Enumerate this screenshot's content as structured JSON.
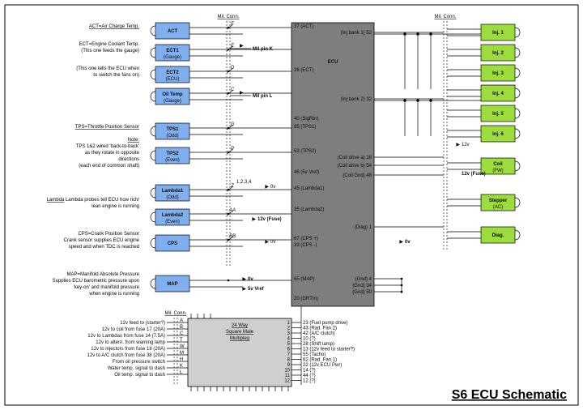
{
  "title": "S6 ECU Schematic",
  "mil_conn": "Mil. Conn.",
  "ecu_label": "ECU",
  "mux": {
    "l1": "24 Way",
    "l2": "Square Male",
    "l3": "Multipleg"
  },
  "sensors": [
    {
      "name": "ACT"
    },
    {
      "name": "ECT1",
      "sub": "(Gauge)"
    },
    {
      "name": "ECT2",
      "sub": "(ECU)"
    },
    {
      "name": "Oil Temp",
      "sub": "(Gauge)"
    },
    {
      "name": "TPS1",
      "sub": "(Odd)"
    },
    {
      "name": "TPS2",
      "sub": "(Even)"
    },
    {
      "name": "Lambda1",
      "sub": "(Odd)"
    },
    {
      "name": "Lambda2",
      "sub": "(Even)"
    },
    {
      "name": "CPS"
    },
    {
      "name": "MAP"
    }
  ],
  "outputs": [
    {
      "name": "Inj. 1"
    },
    {
      "name": "Inj. 2"
    },
    {
      "name": "Inj. 3"
    },
    {
      "name": "Inj. 4"
    },
    {
      "name": "Inj. 5"
    },
    {
      "name": "Inj. 6"
    },
    {
      "name": "Coil",
      "sub": "(FW)"
    },
    {
      "name": "Stepper",
      "sub": "(AC)"
    },
    {
      "name": "Diag."
    }
  ],
  "notes": {
    "act": {
      "l1": "ACT=Air Charge Temp."
    },
    "ect1": {
      "l1": "ECT=Engine Coolant Temp.",
      "l2": "(This one feeds the gauge)"
    },
    "ect2": {
      "l1": "(This one tells the ECU when",
      "l2": "to switch the fans on)"
    },
    "tps_head": "TPS=Throttle Position Sensor",
    "tps_note": {
      "h": "Note:",
      "l1": "TPS 1&2 wired 'back-to-back'",
      "l2": "as they rotate in opposite",
      "l3": "directions",
      "l4": "(each end of common shaft)"
    },
    "lambda": {
      "l1": "Lambda probes tell ECU how rich/",
      "l2": "lean engine is running"
    },
    "cps": {
      "l1": "CPS=Crank Position Sensor",
      "l2": "Crank sensor supplies ECU engine",
      "l3": "speed and when TDC is reached"
    },
    "map": {
      "l1": "MAP=Manifold Absolute Pressure",
      "l2": "Supplies ECU barometric pressure upon",
      "l3": "'key-on' and manifold pressure",
      "l4": "when engine is running"
    }
  },
  "mux_in": [
    "12v feed to (starter?)",
    "12v to coil from fuse 17 (20A)",
    "12v to Lambdas from fuse 14 (7.5A)",
    "12v to altern. from warning lamp",
    "12v to injectors from fuse 18 (20A)",
    "12v to A/C clutch from fuse 38 (20A)",
    "From oil pressure switch",
    "Water temp. signal to dash",
    "Oil temp. signal to dash"
  ],
  "mux_in_pins": [
    "A",
    "B",
    "C",
    "T",
    "W",
    "M",
    "H",
    "K",
    "L"
  ],
  "ecu_left_pins": [
    {
      "n": "37",
      "t": "(ACT)"
    },
    {
      "n": "26",
      "t": "(ECT)"
    },
    {
      "n": "40",
      "t": "(SigRtn)"
    },
    {
      "n": "85",
      "t": "(TPS1)"
    },
    {
      "n": "53",
      "t": "(TPS2)"
    },
    {
      "n": "46",
      "t": "(5v Vref)"
    },
    {
      "n": "45",
      "t": "(Lambda1)"
    },
    {
      "n": "35",
      "t": "(Lambda2)"
    },
    {
      "n": "67",
      "t": "(CPS +)"
    },
    {
      "n": "33",
      "t": "(CPS -)"
    },
    {
      "n": "65",
      "t": "(MAP)"
    },
    {
      "n": "20",
      "t": "(GRTrn)"
    }
  ],
  "ecu_right_pins": [
    {
      "t": "(Inj bank 1)",
      "n": "52"
    },
    {
      "t": "(Inj bank 2)",
      "n": "32"
    },
    {
      "t": "(Coil drive a)",
      "n": "18"
    },
    {
      "t": "(Coil drive b)",
      "n": "54"
    },
    {
      "t": "(Coil Gnd)",
      "n": "48"
    },
    {
      "t": "(Diag)",
      "n": "1"
    }
  ],
  "mux_right": [
    {
      "n": "23",
      "t": "(Fuel pump drive)"
    },
    {
      "n": "43",
      "t": "(Rad. Fan 2)"
    },
    {
      "n": "42",
      "t": "(A/C clutch)"
    },
    {
      "n": "10",
      "t": "(?)"
    },
    {
      "n": "28",
      "t": "(Shift lamp)"
    },
    {
      "n": "13",
      "t": "(12v feed to starter?)"
    },
    {
      "n": "55",
      "t": "(Tacho)"
    },
    {
      "n": "62",
      "t": "(Rad. Fan 1)"
    },
    {
      "n": "22",
      "t": "(12v ECU Pwr)"
    },
    {
      "n": "14",
      "t": "(?)"
    },
    {
      "n": "44",
      "t": "(?)"
    },
    {
      "n": "12",
      "t": "(?)"
    }
  ],
  "gnds": [
    {
      "t": "(Gnd)",
      "n": "4"
    },
    {
      "t": "(Gnd)",
      "n": "34"
    },
    {
      "t": "(Gnd)",
      "n": "50"
    }
  ],
  "rails": {
    "ov": "0v",
    "ov_b": "0v",
    "v12f": "12v (Fuse)",
    "v12f2": "12v (Fuse)",
    "v12": "12v",
    "ov_pins": "1,2,3,4",
    "vref": "5v Vref"
  },
  "mil_pins": {
    "k": "Mil pin K",
    "l": "Mil pin L",
    "c": "C",
    "d": "D",
    "e": "E",
    "f": "F",
    "g": "G",
    "p": "P",
    "z": "Z",
    "aa": "AA",
    "bb": "BB"
  },
  "switches": [
    "F",
    "E",
    "D",
    "C",
    "G",
    "P",
    "Z",
    "AA",
    "BB"
  ],
  "arr": "▶"
}
